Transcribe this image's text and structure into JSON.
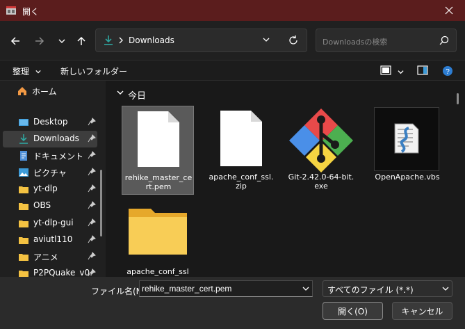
{
  "window": {
    "title": "開く"
  },
  "nav": {
    "address": "Downloads",
    "search_placeholder": "Downloadsの検索"
  },
  "commandbar": {
    "organize": "整理",
    "new_folder": "新しいフォルダー"
  },
  "sidebar": {
    "home": "ホーム",
    "items": [
      {
        "label": "Desktop",
        "icon": "desktop-icon"
      },
      {
        "label": "Downloads",
        "icon": "download-icon",
        "selected": true
      },
      {
        "label": "ドキュメント",
        "icon": "document-icon"
      },
      {
        "label": "ピクチャ",
        "icon": "picture-icon"
      },
      {
        "label": "yt-dlp",
        "icon": "folder-icon"
      },
      {
        "label": "OBS",
        "icon": "folder-icon"
      },
      {
        "label": "yt-dlp-gui",
        "icon": "folder-icon"
      },
      {
        "label": "aviutl110",
        "icon": "folder-icon"
      },
      {
        "label": "アニメ",
        "icon": "folder-icon"
      },
      {
        "label": "P2PQuake_v0.",
        "icon": "folder-icon"
      }
    ]
  },
  "content": {
    "group": "今日",
    "files": [
      {
        "name": "rehike_master_cert.pem",
        "line1": "rehike_master_ce",
        "line2": "rt.pem",
        "type": "file",
        "selected": true
      },
      {
        "name": "apache_conf_ssl.zip",
        "line1": "apache_conf_ssl.",
        "line2": "zip",
        "type": "file"
      },
      {
        "name": "Git-2.42.0-64-bit.exe",
        "line1": "Git-2.42.0-64-bit.",
        "line2": "exe",
        "type": "git"
      },
      {
        "name": "OpenApache.vbs",
        "line1": "OpenApache.vbs",
        "line2": "",
        "type": "script"
      },
      {
        "name": "apache_conf_ssl",
        "line1": "apache_conf_ssl",
        "line2": "",
        "type": "folder"
      }
    ]
  },
  "bottom": {
    "filename_label": "ファイル名(N):",
    "filename_value": "rehike_master_cert.pem",
    "filetype_value": "すべてのファイル (*.*)",
    "open_button": "開く(O)",
    "cancel_button": "キャンセル"
  },
  "colors": {
    "titlebar": "#5b1d1d",
    "accent": "#2fa6a0",
    "folder": "#f4c242"
  }
}
